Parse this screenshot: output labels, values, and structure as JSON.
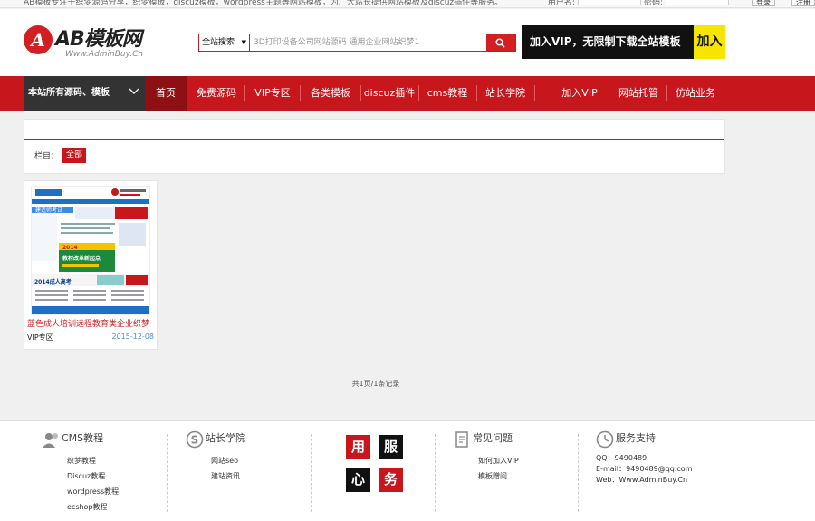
{
  "topbar": {
    "notice": "AB模板专注于织梦源码分享，织梦模板，discuz模板，wordpress主题等网站模板，为广大站长提供网站模板及discuz插件等服务。",
    "username_label": "用户名:",
    "password_label": "密码:",
    "login_button": "登录",
    "register_button": "注册"
  },
  "header": {
    "logo_mark": "A",
    "logo_text": "AB模板网",
    "logo_sub": "Www.AdminBuy.Cn",
    "search_scope": "全站搜索",
    "search_placeholder": "3D打印设备公司网站源码 通用企业网站织梦1",
    "vip_banner_text": "加入VIP，无限制下载全站模板",
    "vip_banner_join": "加入"
  },
  "nav": {
    "all_label": "本站所有源码、模板",
    "items": [
      {
        "label": "首页"
      },
      {
        "label": "免费源码"
      },
      {
        "label": "VIP专区"
      },
      {
        "label": "各类模板"
      },
      {
        "label": "discuz插件"
      },
      {
        "label": "cms教程"
      },
      {
        "label": "站长学院"
      },
      {
        "label": "加入VIP"
      },
      {
        "label": "网站托管"
      },
      {
        "label": "仿站业务"
      }
    ]
  },
  "category": {
    "label": "栏目：",
    "tag": "全部"
  },
  "card": {
    "title": "蓝色成人培训远程教育类企业织梦",
    "category": "VIP专区",
    "date": "2015-12-08",
    "thumb": {
      "banner": "建造师考试",
      "promo_top": "2014",
      "promo_mid": "教材改革新起点",
      "promo_bottom": "2014成人高考"
    }
  },
  "pager": {
    "text": "共1页/1条记录"
  },
  "footer": {
    "columns": [
      {
        "title": "CMS教程",
        "icon": "user-icon",
        "links": [
          "织梦教程",
          "Discuz教程",
          "wordpress教程",
          "ecshop教程"
        ]
      },
      {
        "title": "站长学院",
        "icon": "s-circle-icon",
        "links": [
          "网站seo",
          "建站资讯"
        ]
      },
      {
        "title": "常见问题",
        "icon": "document-icon",
        "links": [
          "如何加入VIP",
          "模板赠问"
        ]
      },
      {
        "title": "服务支持",
        "icon": "clock-icon",
        "links": [
          "QQ：9490489",
          "E-mail：9490489@qq.com",
          "Web：Www.AdminBuy.Cn"
        ]
      }
    ],
    "service_chars": [
      "用",
      "服",
      "心",
      "务"
    ]
  },
  "colors": {
    "brand_red": "#c8161d",
    "active_nav": "#8e0f14",
    "vip_yellow": "#f5e500",
    "date_blue": "#4a90c6"
  }
}
